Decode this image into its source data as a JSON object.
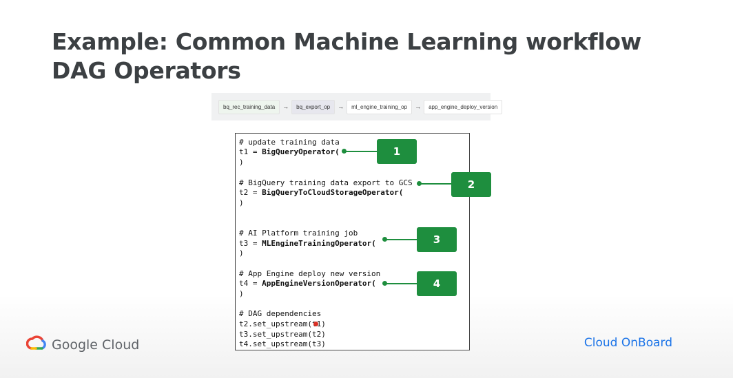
{
  "title": {
    "line1": "Example: Common Machine Learning workflow",
    "line2": "DAG Operators"
  },
  "dag": {
    "nodes": [
      "bq_rec_training_data",
      "bq_export_op",
      "ml_engine_training_op",
      "app_engine_deploy_version"
    ],
    "arrow": "→"
  },
  "code": {
    "c1": "# update training data",
    "t1_prefix": "t1 = ",
    "t1_op": "BigQueryOperator(",
    "close": ")",
    "c2": "# BigQuery training data export to GCS",
    "t2_prefix": "t2 = ",
    "t2_op": "BigQueryToCloudStorageOperator(",
    "c3": "# AI Platform training job",
    "t3_prefix": "t3 = ",
    "t3_op": "MLEngineTrainingOperator(",
    "c4": "# App Engine deploy new version",
    "t4_prefix": "t4 = ",
    "t4_op": "AppEngineVersionOperator(",
    "c5": "# DAG dependencies",
    "dep1": "t2.set_upstream(t1)",
    "dep2": "t3.set_upstream(t2)",
    "dep3": "t4.set_upstream(t3)"
  },
  "badges": [
    "1",
    "2",
    "3",
    "4"
  ],
  "colors": {
    "accent_green": "#1e8e3e",
    "title_gray": "#3c4043",
    "link_blue": "#1a73e8"
  },
  "footer": {
    "brand": "Google Cloud",
    "brand_icon": "google-cloud-logo-icon",
    "right": "Cloud OnBoard"
  }
}
